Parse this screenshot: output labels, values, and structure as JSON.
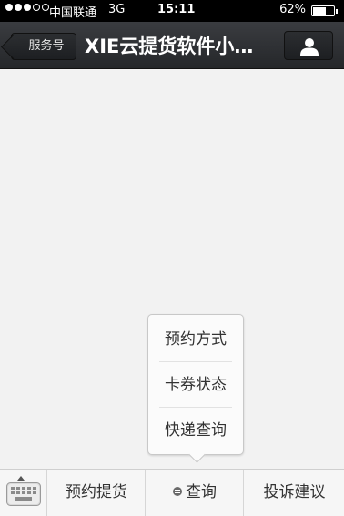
{
  "status_bar": {
    "signal_dots_filled": 3,
    "signal_dots_total": 5,
    "carrier": "中国联通",
    "network": "3G",
    "time": "15:11",
    "battery_percent": "62%",
    "battery_level": 0.62
  },
  "nav_bar": {
    "back_label": "服务号",
    "title": "XIE云提货软件小…",
    "profile_icon": "person-icon"
  },
  "popup_menu": {
    "items": [
      "预约方式",
      "卡券状态",
      "快递查询"
    ]
  },
  "menu_bar": {
    "keyboard_icon": "keyboard-icon",
    "tabs": [
      {
        "label": "预约提货"
      },
      {
        "label": "查询",
        "icon": "menu-list-icon"
      },
      {
        "label": "投诉建议"
      }
    ]
  },
  "colors": {
    "status_bar_bg": "#000000",
    "nav_bar_bg": "#2f3134",
    "content_bg": "#f2f2f2",
    "menu_bar_bg": "#f6f6f6"
  }
}
